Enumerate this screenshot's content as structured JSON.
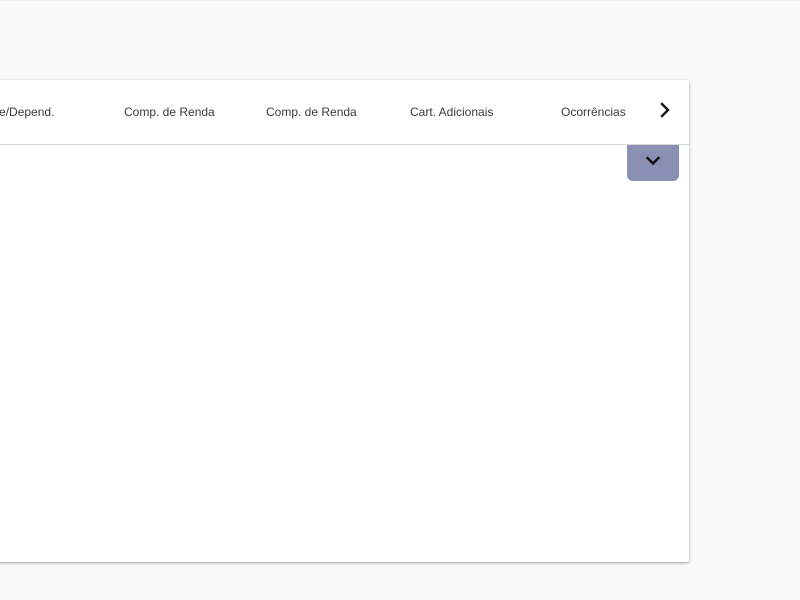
{
  "tabs": [
    {
      "label": "Cônjuge/Depend."
    },
    {
      "label": "Comp. de Renda"
    },
    {
      "label": "Comp. de Renda"
    },
    {
      "label": "Cart. Adicionais"
    },
    {
      "label": "Ocorrências"
    }
  ],
  "icons": {
    "scroll_next": "chevron-right-icon",
    "expand": "chevron-down-icon"
  },
  "colors": {
    "background": "#f9f9f9",
    "card": "#ffffff",
    "toggle_button": "#8a90b4",
    "tab_text": "#3a3a3a"
  }
}
